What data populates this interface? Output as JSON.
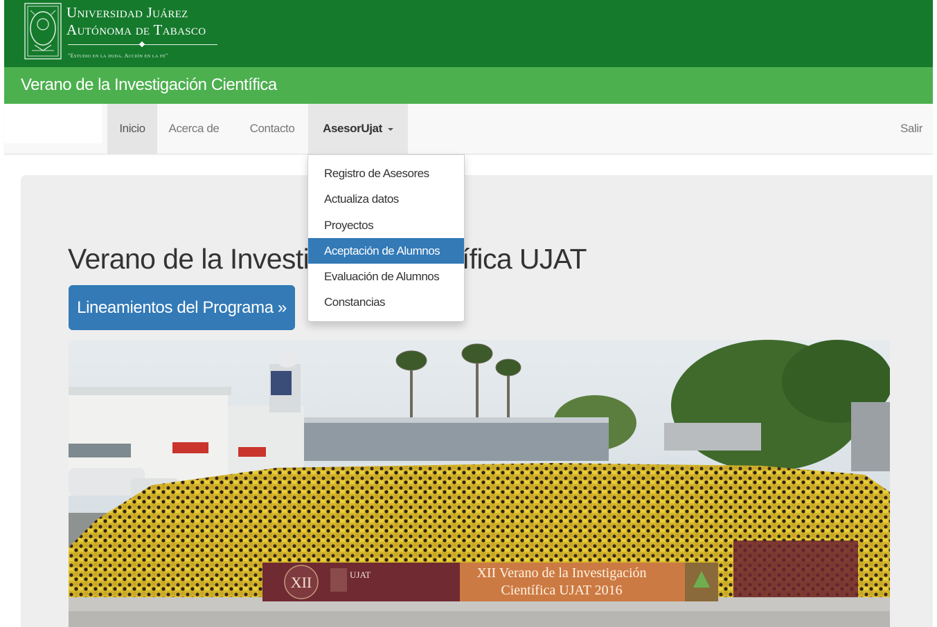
{
  "university": {
    "name_line1": "Universidad Juárez",
    "name_line2": "Autónoma de Tabasco",
    "motto": "\"Estudio en la duda. Acción en la fe\"",
    "bar_color": "#157a2c"
  },
  "program_bar": {
    "title": "Verano de la Investigación Científica",
    "bar_color": "#4cb04f"
  },
  "navbar": {
    "items": [
      {
        "label": "Inicio"
      },
      {
        "label": "Acerca de"
      },
      {
        "label": "Contacto"
      },
      {
        "label": "AsesorUjat",
        "expanded": true
      }
    ],
    "logout_label": "Salir"
  },
  "dropdown": {
    "items": [
      {
        "label": "Registro de Asesores"
      },
      {
        "label": "Actualiza datos"
      },
      {
        "label": "Proyectos"
      },
      {
        "label": "Aceptación de Alumnos",
        "highlighted": true
      },
      {
        "label": "Evaluación de Alumnos"
      },
      {
        "label": "Constancias"
      }
    ],
    "highlight_color": "#337ab7"
  },
  "jumbotron": {
    "title": "Verano de la Investigación Científica UJAT",
    "button_label": "Lineamientos del Programa »",
    "button_color": "#337ab7"
  },
  "photo": {
    "banner_left_numeral": "XII",
    "banner_left_brand": "UJAT",
    "banner_line1": "XII Verano de la Investigación",
    "banner_line2": "Científica UJAT 2016"
  }
}
